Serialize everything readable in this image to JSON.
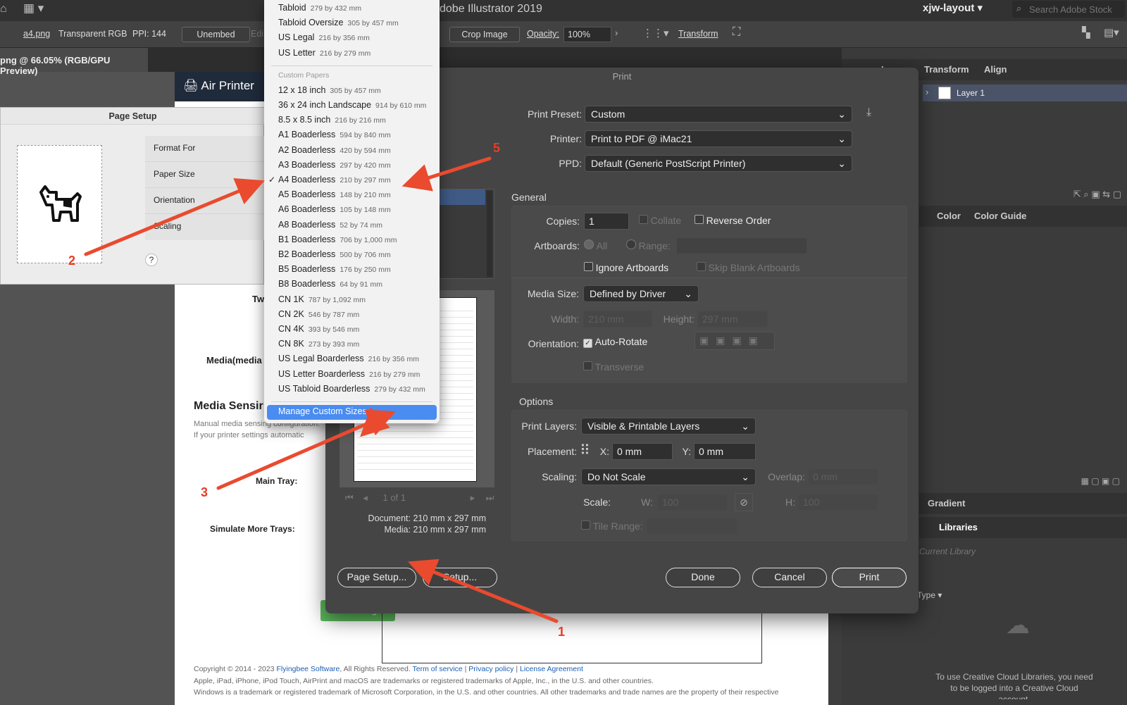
{
  "topbar": {
    "app_title": "dobe Illustrator 2019",
    "workspace": "xjw-layout",
    "search_placeholder": "Search Adobe Stock"
  },
  "controlbar": {
    "filename": "a4.png",
    "color_mode": "Transparent RGB",
    "ppi": "PPI: 144",
    "unembed": "Unembed",
    "edit": "Edi",
    "crop_image": "Crop Image",
    "opacity_label": "Opacity:",
    "opacity_value": "100%",
    "transform": "Transform"
  },
  "doc_tab": "png @ 66.05% (RGB/GPU Preview)",
  "panels": {
    "tabs_top": [
      "Layers",
      "Transform",
      "Align"
    ],
    "layer_name": "Layer 1",
    "tabs_mid": [
      "Color",
      "Color Guide"
    ],
    "tabs_low": [
      "Gradient"
    ],
    "tab_libraries": "Libraries",
    "current_library": "Current Library",
    "type_label": "Type",
    "libraries_msg": "To use Creative Cloud Libraries, you need to be logged into a Creative Cloud account."
  },
  "webpage": {
    "air_printer": "Air Printer",
    "media_sensing_heading": "Media Sensir",
    "media_sensing_desc1": "Manual media sensing configuration.",
    "media_sensing_desc2": "If your printer settings automatic",
    "media_label": "Media(media",
    "tw_label": "Tw",
    "main_tray": "Main Tray:",
    "simulate_trays": "Simulate More Trays:",
    "save_changes": "Save Changes",
    "copyright": "Copyright © 2014 - 2023",
    "company": "Flyingbee Software",
    "rights": ", All Rights Reserved.",
    "links": [
      "Term of service",
      "Privacy policy",
      "License Agreement"
    ],
    "trademark": "Apple, iPad, iPhone, iPod Touch, AirPrint and macOS are trademarks or registered trademarks of Apple, Inc., in the U.S. and other countries.",
    "trademark2": "Windows is a trademark or registered trademark of Microsoft Corporation, in the U.S. and other countries. All other trademarks and trade names are the property of their respective"
  },
  "page_setup": {
    "title": "Page Setup",
    "rows": [
      "Format For",
      "Paper Size",
      "Orientation",
      "Scaling"
    ],
    "help": "?"
  },
  "menu": {
    "items_top": [
      {
        "name": "Tabloid",
        "size": "279 by 432 mm"
      },
      {
        "name": "Tabloid Oversize",
        "size": "305 by 457 mm"
      },
      {
        "name": "US Legal",
        "size": "216 by 356 mm"
      },
      {
        "name": "US Letter",
        "size": "216 by 279 mm"
      }
    ],
    "section_header": "Custom Papers",
    "items_custom": [
      {
        "name": "12 x 18 inch",
        "size": "305 by 457 mm"
      },
      {
        "name": "36 x 24 inch Landscape",
        "size": "914 by 610 mm"
      },
      {
        "name": "8.5 x 8.5 inch",
        "size": "216 by 216 mm"
      },
      {
        "name": "A1 Boaderless",
        "size": "594 by 840 mm"
      },
      {
        "name": "A2 Boaderless",
        "size": "420 by 594 mm"
      },
      {
        "name": "A3 Boaderless",
        "size": "297 by 420 mm"
      },
      {
        "name": "A4 Boaderless",
        "size": "210 by 297 mm"
      },
      {
        "name": "A5 Boaderless",
        "size": "148 by 210 mm"
      },
      {
        "name": "A6 Boaderless",
        "size": "105 by 148 mm"
      },
      {
        "name": "A8 Boaderless",
        "size": "52 by 74 mm"
      },
      {
        "name": "B1 Boaderless",
        "size": "706 by 1,000 mm"
      },
      {
        "name": "B2 Boaderless",
        "size": "500 by 706 mm"
      },
      {
        "name": "B5 Boaderless",
        "size": "176 by 250 mm"
      },
      {
        "name": "B8 Boaderless",
        "size": "64 by 91 mm"
      },
      {
        "name": "CN 1K",
        "size": "787 by 1,092 mm"
      },
      {
        "name": "CN 2K",
        "size": "546 by 787 mm"
      },
      {
        "name": "CN 4K",
        "size": "393 by 546 mm"
      },
      {
        "name": "CN 8K",
        "size": "273 by 393 mm"
      },
      {
        "name": "US Legal Boarderless",
        "size": "216 by 356 mm"
      },
      {
        "name": "US Letter Boarderless",
        "size": "216 by 279 mm"
      },
      {
        "name": "US Tabloid Boarderless",
        "size": "279 by 432 mm"
      }
    ],
    "checked_item": "A4 Boaderless",
    "manage": "Manage Custom Sizes..."
  },
  "print": {
    "title": "Print",
    "preset_label": "Print Preset:",
    "preset": "Custom",
    "printer_label": "Printer:",
    "printer": "Print to PDF @ iMac21",
    "ppd_label": "PPD:",
    "ppd": "Default (Generic PostScript Printer)",
    "general": "General",
    "copies_label": "Copies:",
    "copies": "1",
    "collate": "Collate",
    "reverse": "Reverse Order",
    "artboards_label": "Artboards:",
    "all": "All",
    "range": "Range:",
    "ignore_artboards": "Ignore Artboards",
    "skip_blank": "Skip Blank Artboards",
    "media_size_label": "Media Size:",
    "media_size": "Defined by Driver",
    "width_label": "Width:",
    "width": "210 mm",
    "height_label": "Height:",
    "height": "297 mm",
    "orientation_label": "Orientation:",
    "auto_rotate": "Auto-Rotate",
    "transverse": "Transverse",
    "options": "Options",
    "print_layers_label": "Print Layers:",
    "print_layers": "Visible & Printable Layers",
    "placement_label": "Placement:",
    "x_label": "X:",
    "x": "0 mm",
    "y_label": "Y:",
    "y": "0 mm",
    "scaling_label": "Scaling:",
    "scaling": "Do Not Scale",
    "overlap_label": "Overlap:",
    "overlap": "0 mm",
    "scale_label": "Scale:",
    "w_label": "W:",
    "w": "100",
    "h_label": "H:",
    "h": "100",
    "tile_range": "Tile Range:",
    "page_of": "1 of 1",
    "document_label": "Document:",
    "document": "210 mm x 297 mm",
    "media_label": "Media:",
    "media": "210 mm x 297 mm",
    "page_setup_btn": "Page Setup...",
    "setup_btn": "Setup...",
    "done": "Done",
    "cancel": "Cancel",
    "print_btn": "Print"
  },
  "annotations": [
    "1",
    "2",
    "3",
    "5"
  ],
  "colors": {
    "arrow": "#ea4a2e",
    "menu_highlight": "#4a8cf0",
    "save_green": "#5cb85c",
    "link_blue": "#1a5fb4"
  }
}
